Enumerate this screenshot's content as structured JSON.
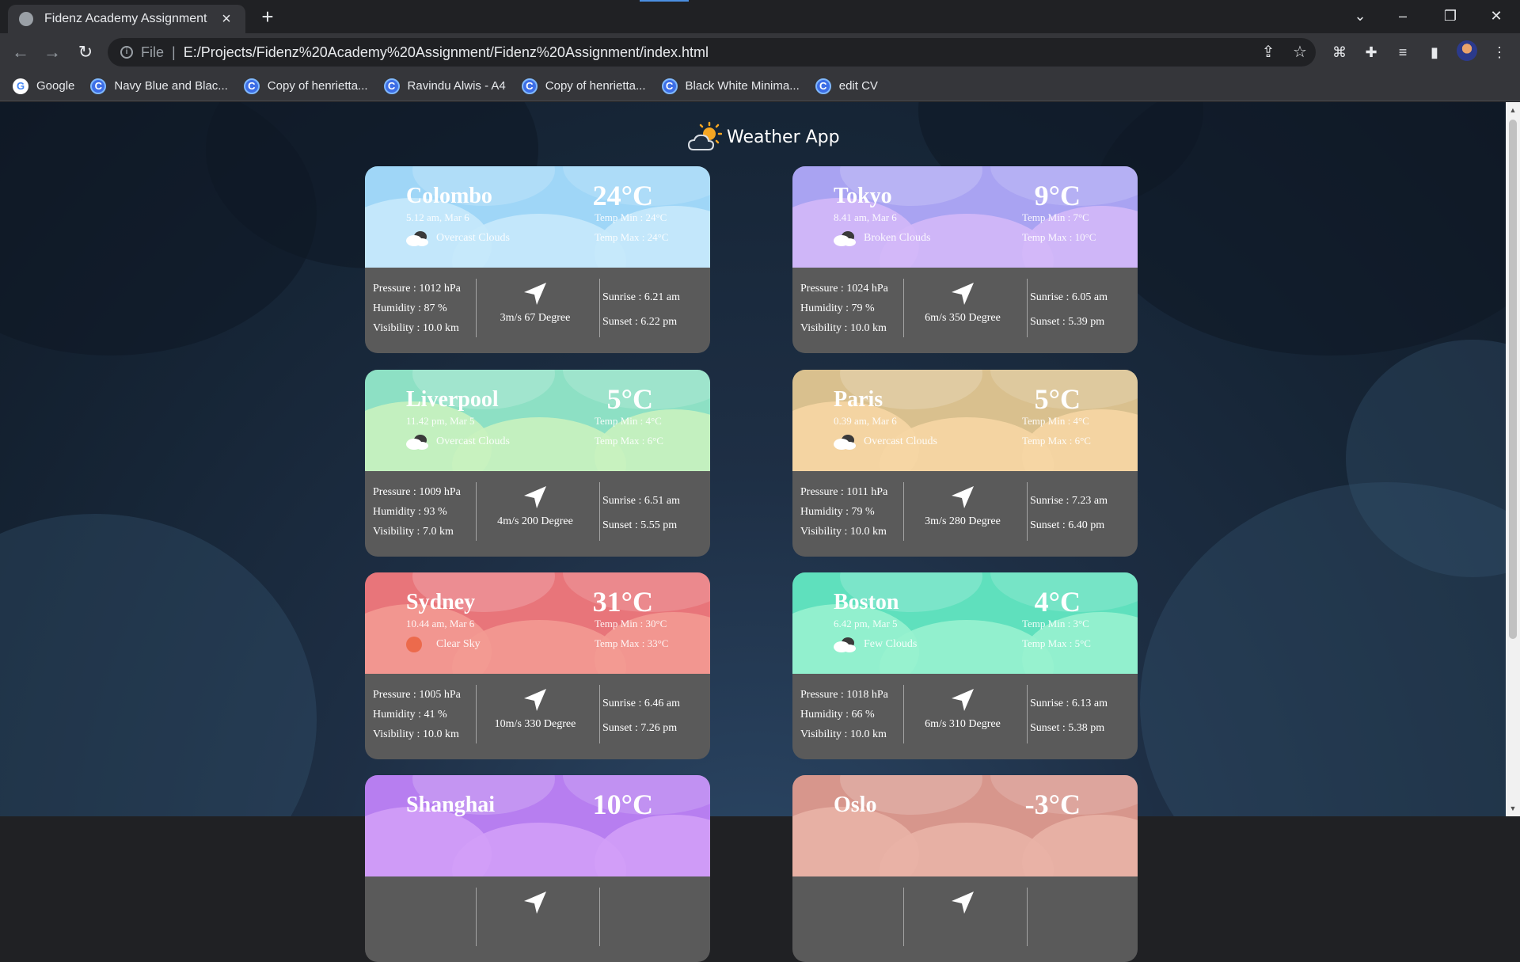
{
  "browser": {
    "tab_title": "Fidenz Academy Assignment",
    "url_scheme": "File",
    "url": "E:/Projects/Fidenz%20Academy%20Assignment/Fidenz%20Assignment/index.html",
    "bookmarks": [
      {
        "label": "Google",
        "icon": "google-icon"
      },
      {
        "label": "Navy Blue and Blac...",
        "icon": "canva-icon"
      },
      {
        "label": "Copy of henrietta...",
        "icon": "canva-icon"
      },
      {
        "label": "Ravindu Alwis - A4",
        "icon": "canva-icon"
      },
      {
        "label": "Copy of henrietta...",
        "icon": "canva-icon"
      },
      {
        "label": "Black White Minima...",
        "icon": "canva-icon"
      },
      {
        "label": "edit CV",
        "icon": "canva-icon"
      }
    ]
  },
  "app": {
    "title": "Weather App"
  },
  "cities": [
    {
      "city": "Colombo",
      "time": "5.12 am, Mar 6",
      "description": "Overcast Clouds",
      "icon": "cloud-icon",
      "temp": "24°C",
      "temp_min": "Temp Min : 24°C",
      "temp_max": "Temp Max : 24°C",
      "pressure": "Pressure : 1012 hPa",
      "humidity": "Humidity : 87 %",
      "visibility": "Visibility : 10.0 km",
      "wind": "3m/s 67 Degree",
      "sunrise": "Sunrise : 6.21 am",
      "sunset": "Sunset : 6.22 pm",
      "color": "#9fd6f7",
      "color2": "#c6e9fb"
    },
    {
      "city": "Tokyo",
      "time": "8.41 am, Mar 6",
      "description": "Broken Clouds",
      "icon": "cloud-icon",
      "temp": "9°C",
      "temp_min": "Temp Min : 7°C",
      "temp_max": "Temp Max : 10°C",
      "pressure": "Pressure : 1024 hPa",
      "humidity": "Humidity : 79 %",
      "visibility": "Visibility : 10.0 km",
      "wind": "6m/s 350 Degree",
      "sunrise": "Sunrise : 6.05 am",
      "sunset": "Sunset : 5.39 pm",
      "color": "#a9a3f2",
      "color2": "#d3b8f8"
    },
    {
      "city": "Liverpool",
      "time": "11.42 pm, Mar 5",
      "description": "Overcast Clouds",
      "icon": "cloud-icon",
      "temp": "5°C",
      "temp_min": "Temp Min : 4°C",
      "temp_max": "Temp Max : 6°C",
      "pressure": "Pressure : 1009 hPa",
      "humidity": "Humidity : 93 %",
      "visibility": "Visibility : 7.0 km",
      "wind": "4m/s 200 Degree",
      "sunrise": "Sunrise : 6.51 am",
      "sunset": "Sunset : 5.55 pm",
      "color": "#8de0c4",
      "color2": "#c9f2bf"
    },
    {
      "city": "Paris",
      "time": "0.39 am, Mar 6",
      "description": "Overcast Clouds",
      "icon": "cloud-icon",
      "temp": "5°C",
      "temp_min": "Temp Min : 4°C",
      "temp_max": "Temp Max : 6°C",
      "pressure": "Pressure : 1011 hPa",
      "humidity": "Humidity : 79 %",
      "visibility": "Visibility : 10.0 km",
      "wind": "3m/s 280 Degree",
      "sunrise": "Sunrise : 7.23 am",
      "sunset": "Sunset : 6.40 pm",
      "color": "#d9c08e",
      "color2": "#f6d6a4"
    },
    {
      "city": "Sydney",
      "time": "10.44 am, Mar 6",
      "description": "Clear Sky",
      "icon": "sun-icon",
      "temp": "31°C",
      "temp_min": "Temp Min : 30°C",
      "temp_max": "Temp Max : 33°C",
      "pressure": "Pressure : 1005 hPa",
      "humidity": "Humidity : 41 %",
      "visibility": "Visibility : 10.0 km",
      "wind": "10m/s 330 Degree",
      "sunrise": "Sunrise : 6.46 am",
      "sunset": "Sunset : 7.26 pm",
      "color": "#e8757a",
      "color2": "#f39a92"
    },
    {
      "city": "Boston",
      "time": "6.42 pm, Mar 5",
      "description": "Few Clouds",
      "icon": "cloud-icon",
      "temp": "4°C",
      "temp_min": "Temp Min : 3°C",
      "temp_max": "Temp Max : 5°C",
      "pressure": "Pressure : 1018 hPa",
      "humidity": "Humidity : 66 %",
      "visibility": "Visibility : 10.0 km",
      "wind": "6m/s 310 Degree",
      "sunrise": "Sunrise : 6.13 am",
      "sunset": "Sunset : 5.38 pm",
      "color": "#5fe0bd",
      "color2": "#98f2cf"
    },
    {
      "city": "Shanghai",
      "time": "",
      "description": "",
      "icon": "",
      "temp": "10°C",
      "temp_min": "",
      "temp_max": "",
      "pressure": "",
      "humidity": "",
      "visibility": "",
      "wind": "",
      "sunrise": "",
      "sunset": "",
      "color": "#b77ef0",
      "color2": "#d29ef7"
    },
    {
      "city": "Oslo",
      "time": "",
      "description": "",
      "icon": "",
      "temp": "-3°C",
      "temp_min": "",
      "temp_max": "",
      "pressure": "",
      "humidity": "",
      "visibility": "",
      "wind": "",
      "sunrise": "",
      "sunset": "",
      "color": "#d7968c",
      "color2": "#e9b2a6"
    }
  ]
}
